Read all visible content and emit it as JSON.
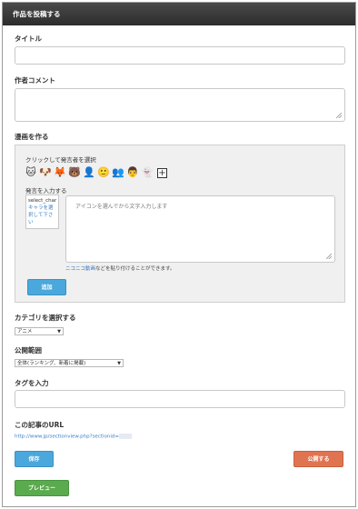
{
  "header": {
    "title": "作品を投稿する"
  },
  "title_field": {
    "label": "タイトル",
    "value": ""
  },
  "comment_field": {
    "label": "作者コメント",
    "value": ""
  },
  "composer": {
    "label": "漫画を作る",
    "choose_speaker_label": "クリックして発言者を選択",
    "characters": [
      {
        "icon": "cat-face-icon",
        "glyph": "🐱"
      },
      {
        "icon": "dog-face-icon",
        "glyph": "🐶"
      },
      {
        "icon": "fox-face-icon",
        "glyph": "🦊"
      },
      {
        "icon": "bear-face-icon",
        "glyph": "🐻"
      },
      {
        "icon": "person-blue-icon",
        "glyph": "👤"
      },
      {
        "icon": "person-orange-icon",
        "glyph": "🙂"
      },
      {
        "icon": "person-gray-icon",
        "glyph": "👥"
      },
      {
        "icon": "person-dark-icon",
        "glyph": "👨"
      },
      {
        "icon": "person-light-icon",
        "glyph": "👻"
      }
    ],
    "add_label": "+",
    "speaker_label": "発言を入力する",
    "select_char_code": "select_char",
    "select_char_hint": "キャラを選択して下さい",
    "talk_placeholder": "アイコンを選んでから文字入力します",
    "note_link": "ニコニコ動画",
    "note_text": "などを貼り付けることができます。",
    "append_button": "追加"
  },
  "category": {
    "label": "カテゴリを選択する",
    "selected": "アニメ"
  },
  "visibility": {
    "label": "公開範囲",
    "selected": "全体(ランキング、新着に掲載)"
  },
  "tags": {
    "label": "タグを入力",
    "value": ""
  },
  "url_section": {
    "label": "この記事のURL",
    "url": "http://www.jp/sectionview.php?sectionid="
  },
  "buttons": {
    "save": "保存",
    "publish": "公開する",
    "preview": "プレビュー"
  },
  "colors": {
    "header": "#333333",
    "save": "#4aa8dc",
    "publish": "#e07451",
    "preview": "#5aaa4e",
    "link": "#3a7ec4"
  }
}
